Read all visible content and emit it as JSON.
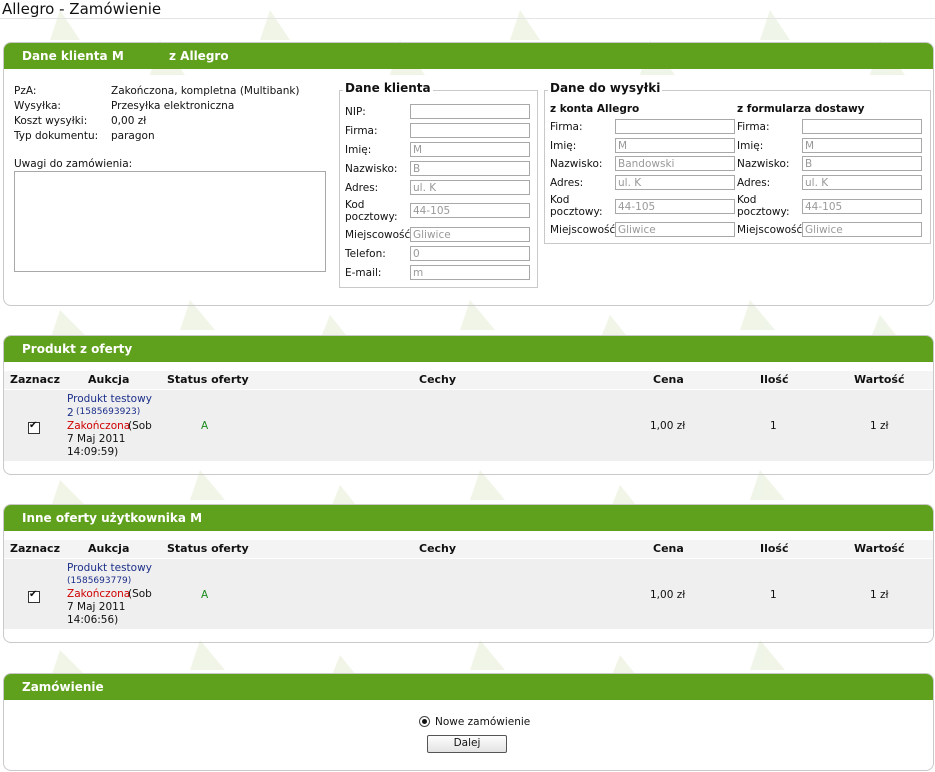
{
  "page_title": "Allegro - Zamówienie",
  "client_panel": {
    "header_left": "Dane klienta M",
    "header_right": "z Allegro",
    "info": [
      {
        "label": "PzA:",
        "value": "Zakończona, kompletna (Multibank)"
      },
      {
        "label": "Wysyłka:",
        "value": "Przesyłka elektroniczna"
      },
      {
        "label": "Koszt wysyłki:",
        "value": "0,00 zł"
      },
      {
        "label": "Typ dokumentu:",
        "value": "paragon"
      }
    ],
    "notes_label": "Uwagi do zamówienia:",
    "notes_value": "",
    "client_data": {
      "legend": "Dane klienta",
      "fields": [
        {
          "label": "NIP:",
          "value": ""
        },
        {
          "label": "Firma:",
          "value": ""
        },
        {
          "label": "Imię:",
          "value": "M"
        },
        {
          "label": "Nazwisko:",
          "value": "B"
        },
        {
          "label": "Adres:",
          "value": "ul. K"
        },
        {
          "label": "Kod pocztowy:",
          "label_line1": "Kod",
          "label_line2": "pocztowy:",
          "value": "44-105"
        },
        {
          "label": "Miejscowość:",
          "value": "Gliwice"
        },
        {
          "label": "Telefon:",
          "value": "0"
        },
        {
          "label": "E-mail:",
          "value": "m"
        }
      ]
    },
    "shipping": {
      "legend": "Dane do wysyłki",
      "col1_title": "z konta Allegro",
      "col2_title": "z formularza dostawy",
      "col1": [
        {
          "label": "Firma:",
          "value": ""
        },
        {
          "label": "Imię:",
          "value": "M"
        },
        {
          "label": "Nazwisko:",
          "value": "Bandowski"
        },
        {
          "label": "Adres:",
          "value": "ul. K"
        },
        {
          "label_line1": "Kod",
          "label_line2": "pocztowy:",
          "value": "44-105"
        },
        {
          "label": "Miejscowość:",
          "value": "Gliwice"
        }
      ],
      "col2": [
        {
          "label": "Firma:",
          "value": ""
        },
        {
          "label": "Imię:",
          "value": "M"
        },
        {
          "label": "Nazwisko:",
          "value": "B"
        },
        {
          "label": "Adres:",
          "value": "ul. K"
        },
        {
          "label_line1": "Kod",
          "label_line2": "pocztowy:",
          "value": "44-105"
        },
        {
          "label": "Miejscowość:",
          "value": "Gliwice"
        }
      ]
    }
  },
  "table_headers": {
    "select": "Zaznacz",
    "auction": "Aukcja",
    "status": "Status oferty",
    "features": "Cechy",
    "price": "Cena",
    "qty": "Ilość",
    "value": "Wartość"
  },
  "offer_panel": {
    "header": "Produkt z oferty",
    "row": {
      "checked": true,
      "product_line1": "Produkt testowy",
      "product_line2": "2",
      "auction_id": "(1585693923)",
      "status_word": "Zakończona",
      "date_line1": "(Sob",
      "date_line2": "7 Maj 2011",
      "date_line3": "14:09:59)",
      "offer_status": "A",
      "features": "",
      "price": "1,00 zł",
      "qty": "1",
      "value": "1 zł"
    }
  },
  "other_panel": {
    "header": "Inne oferty użytkownika M",
    "row": {
      "checked": true,
      "product_line1": "Produkt testowy",
      "auction_id": "(1585693779)",
      "status_word": "Zakończona",
      "date_line1": "(Sob",
      "date_line2": "7 Maj 2011",
      "date_line3": "14:06:56)",
      "offer_status": "A",
      "features": "",
      "price": "1,00 zł",
      "qty": "1",
      "value": "1 zł"
    }
  },
  "order_panel": {
    "header": "Zamówienie",
    "radio_label": "Nowe zamówienie",
    "radio_checked": true,
    "button_label": "Dalej"
  },
  "colors": {
    "header_green": "#5fa01c",
    "link_blue": "#1c2f8a",
    "status_red": "#d00000",
    "status_green": "#1a8c1a"
  }
}
